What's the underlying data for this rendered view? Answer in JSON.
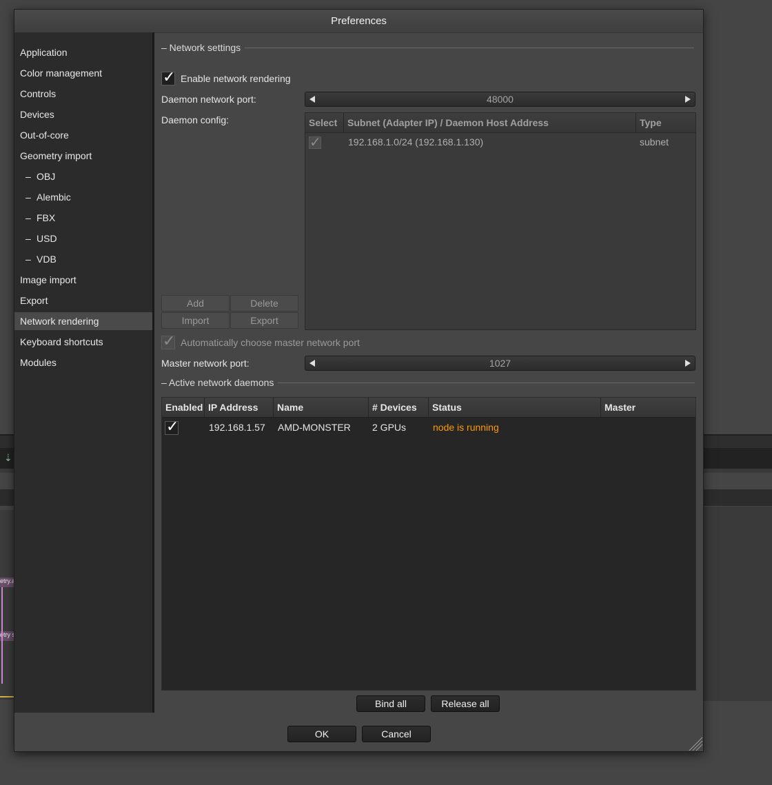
{
  "window": {
    "title": "Preferences"
  },
  "sidebar": {
    "items": [
      {
        "label": "Application"
      },
      {
        "label": "Color management"
      },
      {
        "label": "Controls"
      },
      {
        "label": "Devices"
      },
      {
        "label": "Out-of-core"
      },
      {
        "label": "Geometry import"
      },
      {
        "label": "OBJ",
        "sub": true
      },
      {
        "label": "Alembic",
        "sub": true
      },
      {
        "label": "FBX",
        "sub": true
      },
      {
        "label": "USD",
        "sub": true
      },
      {
        "label": "VDB",
        "sub": true
      },
      {
        "label": "Image import"
      },
      {
        "label": "Export"
      },
      {
        "label": "Network rendering",
        "selected": true
      },
      {
        "label": "Keyboard shortcuts"
      },
      {
        "label": "Modules"
      }
    ],
    "sub_prefix": "–"
  },
  "network_settings": {
    "section_title": "– Network settings",
    "enable_label": "Enable network rendering",
    "enable_checked": true,
    "daemon_port_label": "Daemon network port:",
    "daemon_port_value": "48000",
    "daemon_config_label": "Daemon config:",
    "config_table": {
      "headers": [
        "Select",
        "Subnet (Adapter IP) / Daemon Host Address",
        "Type"
      ],
      "rows": [
        {
          "selected": true,
          "address": "192.168.1.0/24 (192.168.1.130)",
          "type": "subnet"
        }
      ]
    },
    "buttons": {
      "add": "Add",
      "delete": "Delete",
      "import": "Import",
      "export": "Export"
    },
    "auto_master_label": "Automatically choose master network port",
    "auto_master_checked": true,
    "master_port_label": "Master network port:",
    "master_port_value": "1027"
  },
  "active_daemons": {
    "section_title": "– Active network daemons",
    "headers": [
      "Enabled",
      "IP Address",
      "Name",
      "# Devices",
      "Status",
      "Master"
    ],
    "rows": [
      {
        "enabled": true,
        "ip": "192.168.1.57",
        "name": "AMD-MONSTER",
        "devices": "2 GPUs",
        "status": "node is running",
        "master": ""
      }
    ],
    "bind_all": "Bind all",
    "release_all": "Release all"
  },
  "footer": {
    "ok": "OK",
    "cancel": "Cancel"
  },
  "colors": {
    "status_running": "#ff9900",
    "accent_bg": "#464646"
  },
  "background": {
    "node_label_1": "etry.a",
    "node_label_2": "etry s"
  }
}
